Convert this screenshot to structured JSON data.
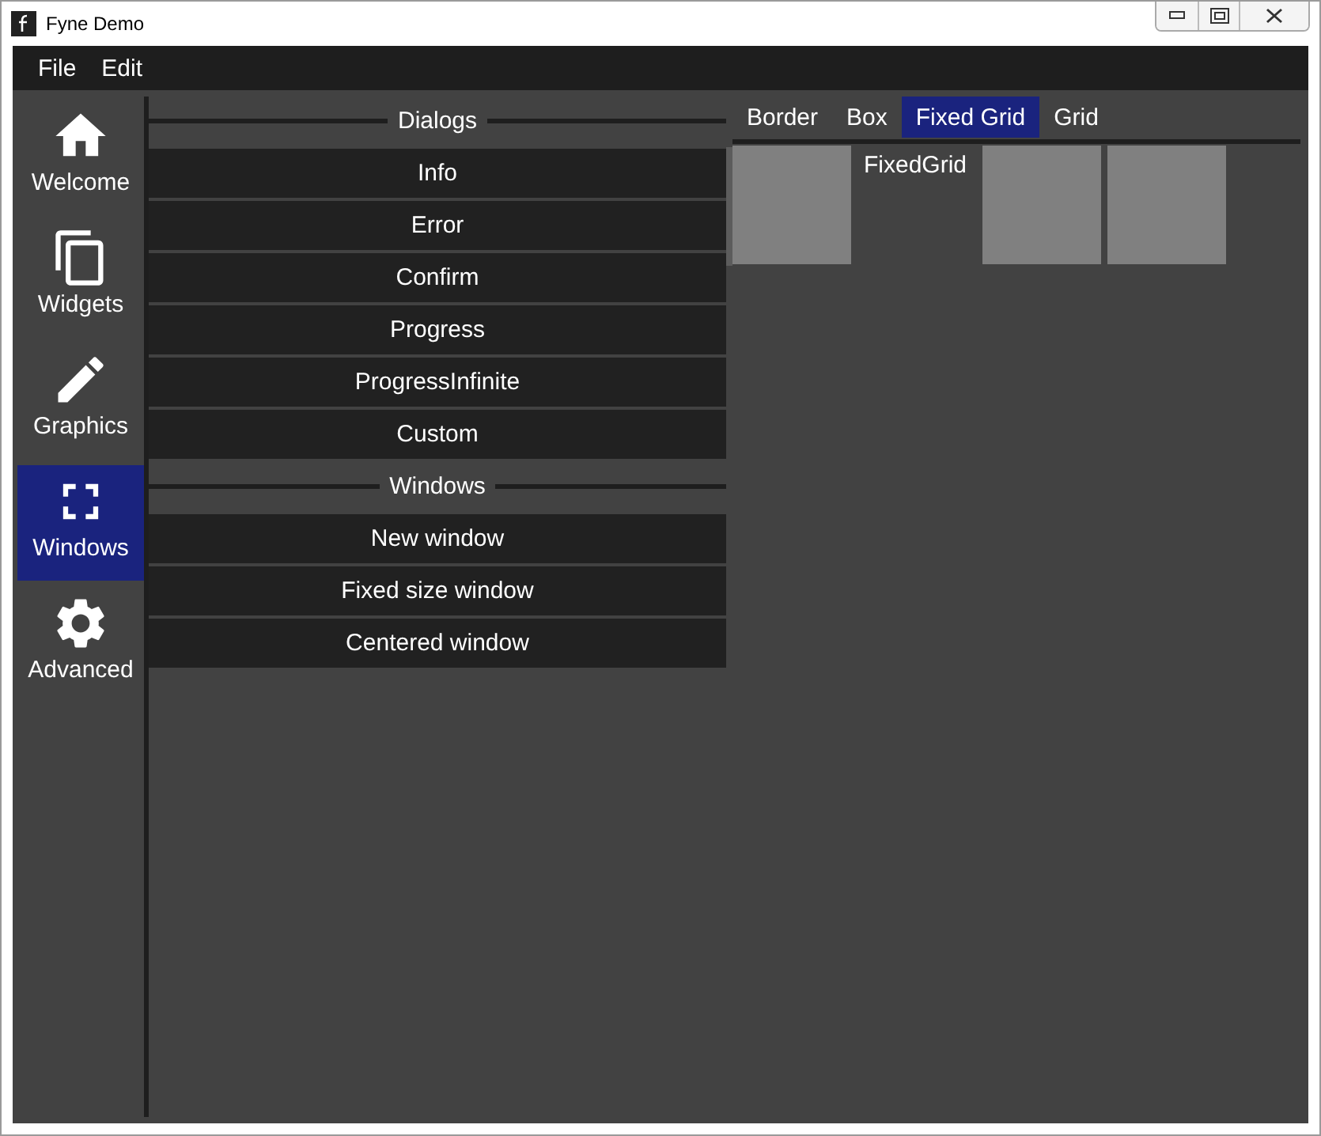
{
  "window": {
    "title": "Fyne Demo"
  },
  "menu": [
    "File",
    "Edit"
  ],
  "sidebar": {
    "items": [
      {
        "label": "Welcome",
        "kind": "home",
        "selected": false
      },
      {
        "label": "Widgets",
        "kind": "copy",
        "selected": false
      },
      {
        "label": "Graphics",
        "kind": "pencil",
        "selected": false
      },
      {
        "label": "Windows",
        "kind": "fullscreen",
        "selected": true
      },
      {
        "label": "Advanced",
        "kind": "gear",
        "selected": false
      }
    ]
  },
  "sections": [
    {
      "title": "Dialogs",
      "buttons": [
        "Info",
        "Error",
        "Confirm",
        "Progress",
        "ProgressInfinite",
        "Custom"
      ]
    },
    {
      "title": "Windows",
      "buttons": [
        "New window",
        "Fixed size window",
        "Centered window"
      ]
    }
  ],
  "tabs": [
    {
      "label": "Border",
      "selected": false
    },
    {
      "label": "Box",
      "selected": false
    },
    {
      "label": "Fixed Grid",
      "selected": true
    },
    {
      "label": "Grid",
      "selected": false
    }
  ],
  "fixed_grid": {
    "cells": [
      {
        "kind": "block"
      },
      {
        "kind": "text",
        "text": "FixedGrid"
      },
      {
        "kind": "block"
      },
      {
        "kind": "block"
      }
    ]
  }
}
